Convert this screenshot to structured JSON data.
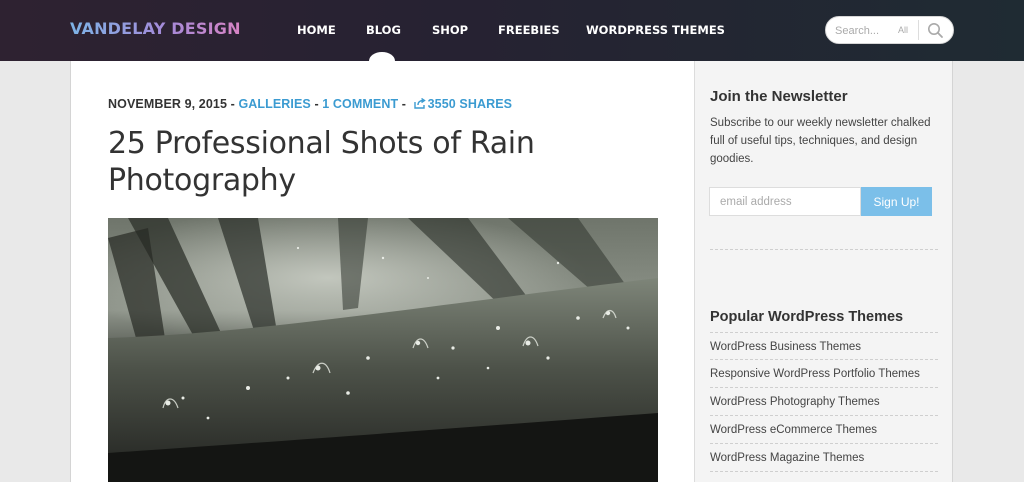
{
  "header": {
    "logo": "VANDELAY DESIGN",
    "nav": [
      {
        "label": "HOME"
      },
      {
        "label": "BLOG"
      },
      {
        "label": "SHOP"
      },
      {
        "label": "FREEBIES"
      },
      {
        "label": "WORDPRESS THEMES"
      }
    ],
    "active_nav": "BLOG",
    "search": {
      "placeholder": "Search...",
      "scope": "All"
    }
  },
  "post": {
    "date": "NOVEMBER 9, 2015",
    "category": "GALLERIES",
    "comments": "1 COMMENT",
    "shares": "3550 SHARES",
    "title": "25 Professional Shots of Rain Photography",
    "image_icon": "rain-photo"
  },
  "sidebar": {
    "newsletter": {
      "title": "Join the Newsletter",
      "text": "Subscribe to our weekly newsletter chalked full of useful tips, techniques, and design goodies.",
      "email_placeholder": "email address",
      "button": "Sign Up!"
    },
    "popular": {
      "title": "Popular WordPress Themes",
      "items": [
        {
          "label": "WordPress Business Themes"
        },
        {
          "label": "Responsive WordPress Portfolio Themes"
        },
        {
          "label": "WordPress Photography Themes"
        },
        {
          "label": "WordPress eCommerce Themes"
        },
        {
          "label": "WordPress Magazine Themes"
        }
      ]
    }
  },
  "colors": {
    "accent": "#3b9bd1",
    "button": "#7bbfe9",
    "header_bg": "#262232"
  }
}
